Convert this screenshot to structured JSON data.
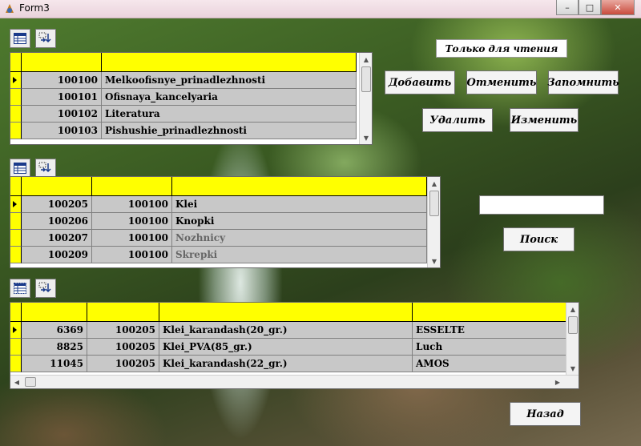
{
  "window": {
    "title": "Form3",
    "minimize": "–",
    "maximize": "□",
    "close": "✕"
  },
  "grid1": {
    "rows": [
      {
        "code": "100100",
        "name": "Melkoofisnye_prinadlezhnosti"
      },
      {
        "code": "100101",
        "name": "Ofisnaya_kancelyaria"
      },
      {
        "code": "100102",
        "name": "Literatura"
      },
      {
        "code": "100103",
        "name": "Pishushie_prinadlezhnosti"
      }
    ]
  },
  "grid2": {
    "rows": [
      {
        "id": "100205",
        "parent": "100100",
        "name": "Klei"
      },
      {
        "id": "100206",
        "parent": "100100",
        "name": "Knopki"
      },
      {
        "id": "100207",
        "parent": "100100",
        "name": "Nozhnicy"
      },
      {
        "id": "100209",
        "parent": "100100",
        "name": "Skrepki"
      }
    ]
  },
  "grid3": {
    "rows": [
      {
        "id": "6369",
        "group": "100205",
        "name": "Klei_karandash(20_gr.)",
        "maker": "ESSELTE"
      },
      {
        "id": "8825",
        "group": "100205",
        "name": "Klei_PVA(85_gr.)",
        "maker": "Luch"
      },
      {
        "id": "11045",
        "group": "100205",
        "name": "Klei_karandash(22_gr.)",
        "maker": "AMOS"
      }
    ]
  },
  "readonly_label": "Только для чтения",
  "buttons": {
    "add": "Добавить",
    "cancel": "Отменить",
    "save": "Запомнить",
    "delete": "Удалить",
    "edit": "Изменить",
    "search": "Поиск",
    "back": "Назад"
  },
  "search": {
    "value": ""
  },
  "colors": {
    "header": "#ffff00",
    "cell": "#c8c8c8"
  },
  "icons": {
    "grid_view": "table-grid-icon",
    "sort": "sort-arrows-icon"
  }
}
